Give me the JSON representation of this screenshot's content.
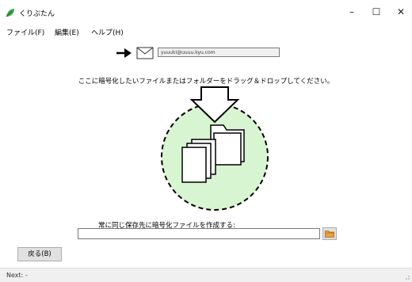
{
  "window": {
    "title": "くりぷたん",
    "minimize": "–",
    "maximize": "☐",
    "close": "✕"
  },
  "menu": {
    "items": [
      "ファイル(F)",
      "編集(E)",
      "ヘルプ(H)"
    ]
  },
  "recipient": {
    "arrow_icon": "right-arrow-icon",
    "mail_icon": "envelope-icon",
    "email": "yuuuki@uuuu.kyu.com"
  },
  "drop": {
    "instruction": "ここに暗号化したいファイルまたはフォルダーをドラッグ＆ドロップしてください。",
    "icon": "file-folder-drop-icon",
    "circle_color": "#d6f5d0"
  },
  "save": {
    "label": "常に同じ保存先に暗号化ファイルを作成する:",
    "path": "",
    "browse_icon": "folder-icon"
  },
  "buttons": {
    "back": "戻る(B)"
  },
  "status": {
    "text": "Next: -"
  },
  "colors": {
    "accent_green": "#3aa845",
    "folder_orange": "#e8a13a"
  }
}
